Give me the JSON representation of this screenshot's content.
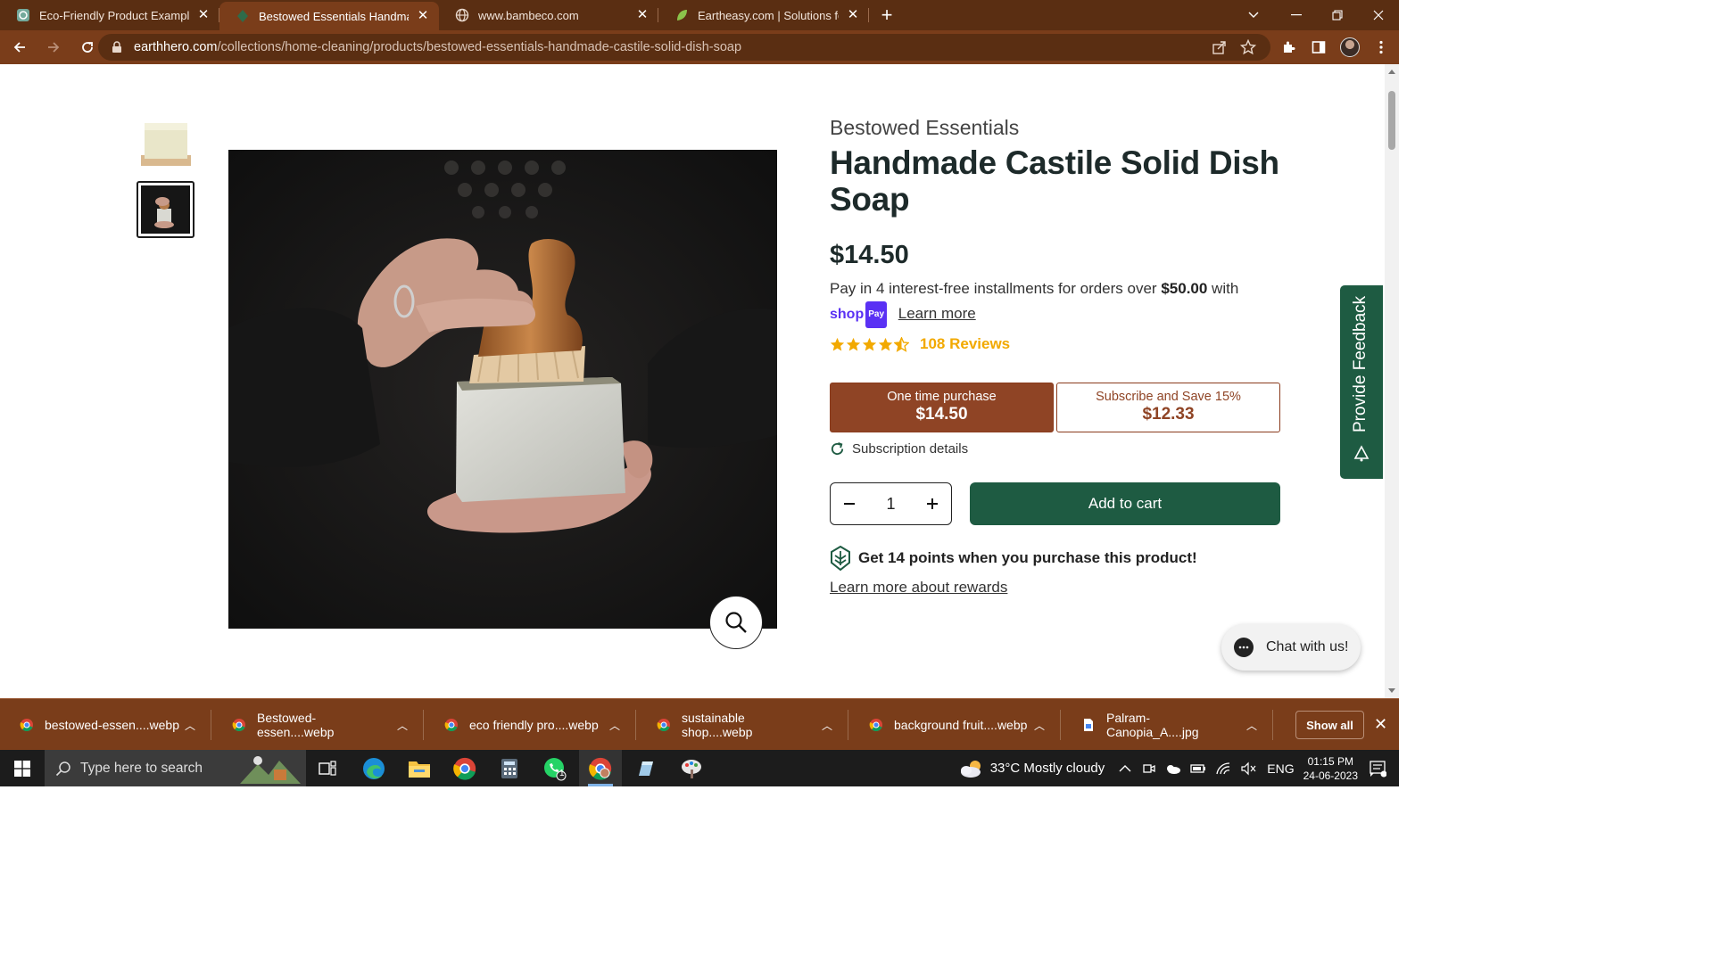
{
  "browser": {
    "tabs": [
      {
        "title": "Eco-Friendly Product Examples",
        "icon": "chatgpt-icon",
        "active": false
      },
      {
        "title": "Bestowed Essentials Handmade C",
        "icon": "earthhero-icon",
        "active": true
      },
      {
        "title": "www.bambeco.com",
        "icon": "globe-icon",
        "active": false
      },
      {
        "title": "Eartheasy.com | Solutions for Sus",
        "icon": "leaf-icon",
        "active": false
      }
    ],
    "url_host": "earthhero.com",
    "url_path": "/collections/home-cleaning/products/bestowed-essentials-handmade-castile-solid-dish-soap"
  },
  "product": {
    "brand": "Bestowed Essentials",
    "title": "Handmade Castile Solid Dish Soap",
    "price": "$14.50",
    "installments_text": "Pay in 4 interest-free installments for orders over ",
    "installments_amount": "$50.00",
    "installments_suffix": " with",
    "shoppay_label": "shop",
    "shoppay_badge": "Pay",
    "learn_more": "Learn more",
    "rating": 4.5,
    "reviews": "108 Reviews",
    "one_time_label": "One time purchase",
    "one_time_price": "$14.50",
    "subscribe_label": "Subscribe and Save 15%",
    "subscribe_price": "$12.33",
    "subscription_details": "Subscription details",
    "quantity": "1",
    "add_to_cart": "Add to cart",
    "points_text": "Get 14 points when you purchase this product!",
    "rewards_link": "Learn more about rewards"
  },
  "widgets": {
    "feedback": "Provide Feedback",
    "chat": "Chat with us!"
  },
  "downloads": {
    "items": [
      {
        "name": "bestowed-essen....webp",
        "icon": "chrome-icon"
      },
      {
        "name": "Bestowed-essen....webp",
        "icon": "chrome-icon"
      },
      {
        "name": "eco friendly pro....webp",
        "icon": "chrome-icon"
      },
      {
        "name": "sustainable shop....webp",
        "icon": "chrome-icon"
      },
      {
        "name": "background fruit....webp",
        "icon": "chrome-icon"
      },
      {
        "name": "Palram-Canopia_A....jpg",
        "icon": "file-icon"
      }
    ],
    "show_all": "Show all"
  },
  "taskbar": {
    "search_placeholder": "Type here to search",
    "weather": "33°C  Mostly cloudy",
    "lang": "ENG",
    "time": "01:15 PM",
    "date": "24-06-2023",
    "whatsapp_badge": "1"
  },
  "colors": {
    "chrome_frame": "#5a2e12",
    "chrome_toolbar": "#7a3d1a",
    "brand_green": "#1e5b42",
    "purchase_brown": "#8f4425",
    "star_gold": "#f2a900"
  }
}
